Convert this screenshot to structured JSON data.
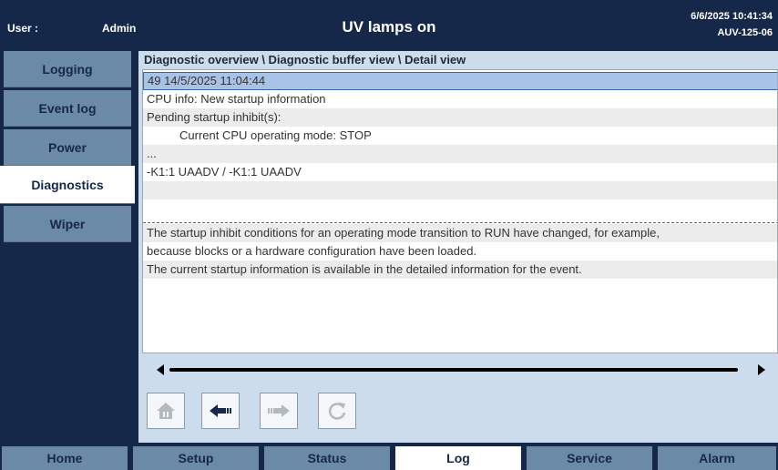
{
  "header": {
    "user_label": "User :",
    "user_value": "Admin",
    "title": "UV lamps on",
    "datetime": "6/6/2025 10:41:34",
    "device": "AUV-125-06"
  },
  "sidebar": {
    "items": [
      {
        "label": "Logging"
      },
      {
        "label": "Event log"
      },
      {
        "label": "Power"
      },
      {
        "label": "Diagnostics",
        "active": true
      },
      {
        "label": "Wiper"
      }
    ]
  },
  "breadcrumb": "Diagnostic overview \\ Diagnostic buffer view \\ Detail view",
  "detail": {
    "lines": [
      "49 14/5/2025 11:04:44",
      "CPU info: New startup information",
      "Pending startup inhibit(s):",
      "Current CPU operating mode: STOP",
      "...",
      "-K1:1 UAADV / -K1:1 UAADV",
      "",
      ""
    ],
    "description": [
      "The startup inhibit conditions for an operating mode transition to RUN have changed, for example,",
      "because blocks or a hardware configuration have been loaded.",
      " The current startup information is available in the detailed information for the event."
    ]
  },
  "toolbar": {
    "buttons": [
      {
        "icon": "home-icon",
        "enabled": false
      },
      {
        "icon": "arrow-left-icon",
        "enabled": true
      },
      {
        "icon": "arrow-right-icon",
        "enabled": false
      },
      {
        "icon": "refresh-icon",
        "enabled": false
      }
    ]
  },
  "footer": {
    "items": [
      {
        "label": "Home"
      },
      {
        "label": "Setup"
      },
      {
        "label": "Status"
      },
      {
        "label": "Log",
        "active": true
      },
      {
        "label": "Service"
      },
      {
        "label": "Alarm"
      }
    ]
  },
  "colors": {
    "header_bg": "#16284a",
    "nav_button": "#6b8aa5",
    "active": "#ffffff",
    "content_bg": "#ccdcec",
    "selection": "#a9c3e8"
  }
}
